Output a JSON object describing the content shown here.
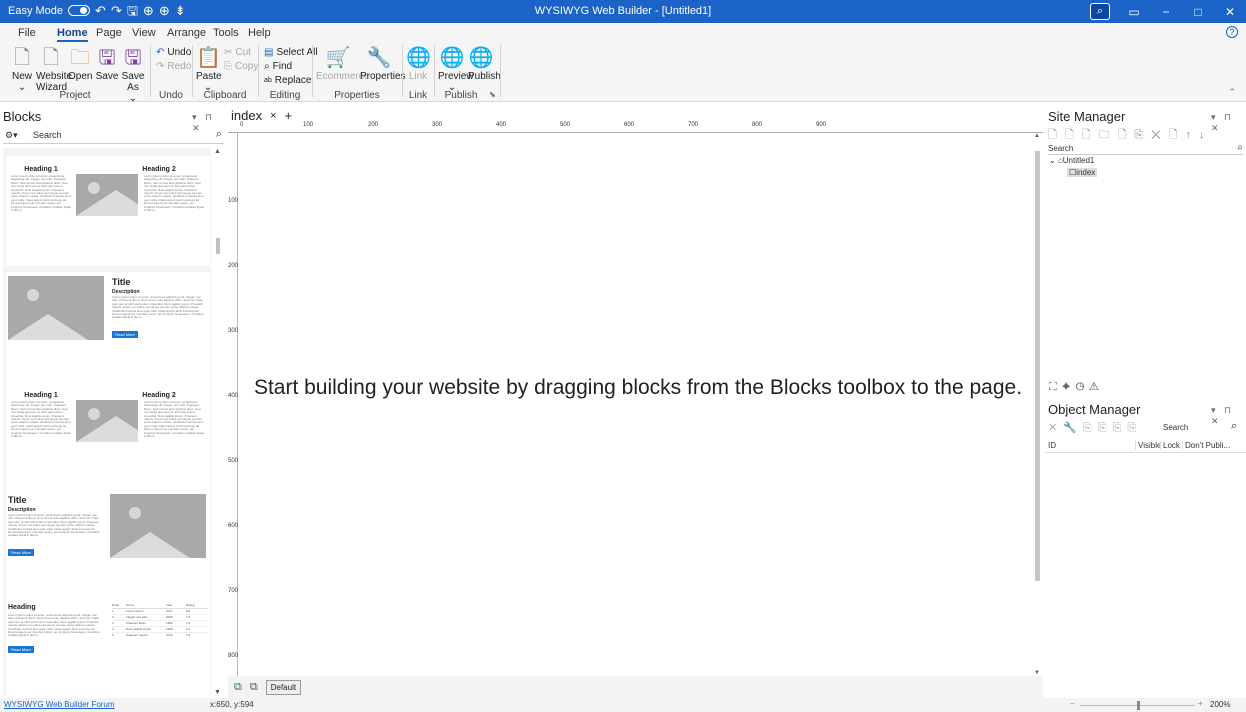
{
  "titlebar": {
    "easy_mode": "Easy Mode",
    "title": "WYSIWYG Web Builder - [Untitled1]",
    "minimize": "−",
    "maximize": "□",
    "close": "✕"
  },
  "menu": {
    "tabs": [
      "File",
      "Home",
      "Page",
      "View",
      "Arrange",
      "Tools",
      "Help"
    ],
    "help": "?"
  },
  "ribbon": {
    "new": "New",
    "website_wizard": "Website Wizard",
    "open": "Open",
    "save": "Save",
    "save_as": "Save As",
    "project_group": "Project",
    "undo": "Undo",
    "redo": "Redo",
    "undo_group": "Undo",
    "paste": "Paste",
    "cut": "Cut",
    "copy": "Copy",
    "clipboard_group": "Clipboard",
    "select_all": "Select All",
    "find": "Find",
    "replace": "Replace",
    "editing_group": "Editing",
    "ecommerce": "Ecommerce",
    "properties": "Properties",
    "properties_group": "Properties",
    "link": "Link",
    "link_group": "Link",
    "preview": "Preview",
    "publish": "Publish",
    "publish_group": "Publish"
  },
  "blocks": {
    "title": "Blocks",
    "search_placeholder": "Search",
    "card1": {
      "h1": "Heading 1",
      "h2": "Heading 2"
    },
    "card2": {
      "title": "Title",
      "desc": "Description",
      "btn": "Read More"
    },
    "card3": {
      "h1": "Heading 1",
      "h2": "Heading 2"
    },
    "card4": {
      "title": "Title",
      "desc": "Description",
      "btn": "Read More"
    },
    "card5": {
      "title": "Heading",
      "btn": "Read More",
      "cols": [
        "Rank",
        "Name",
        "Year",
        "Rating"
      ],
      "rows": [
        [
          "1",
          "Lorem ipsum",
          "2017",
          "8.8"
        ],
        [
          "2",
          "Integer nec odio",
          "2005",
          "7.6"
        ],
        [
          "3",
          "Praesent libero",
          "1982",
          "7.5"
        ],
        [
          "4",
          "Duis sagittis ipsum",
          "1996",
          "8.1"
        ],
        [
          "5",
          "Praesent mauris",
          "2012",
          "7.9"
        ]
      ]
    },
    "lorem": "Lorem ipsum dolor sit amet, consectetur adipiscing elit. Integer nec odio. Praesent libero. Sed cursus ante dapibus diam. Sed nisi. Nulla quis sem at nibh elementum imperdiet. Duis sagittis ipsum. Praesent mauris. Fusce nec tellus sed augue semper porta. Mauris massa. Vestibulum lacinia arcu eget nulla. Class aptent taciti sociosqu ad litora torquent per conubia nostra, per inceptos himenaeos. Curabitur sodales ligula in libero."
  },
  "editor": {
    "tab": "index",
    "tab_close": "×",
    "tab_add": "+",
    "hruler": [
      "0",
      "100",
      "200",
      "300",
      "400",
      "500",
      "600",
      "700",
      "800",
      "900"
    ],
    "vruler": [
      "100",
      "200",
      "300",
      "400",
      "500",
      "600",
      "700",
      "800"
    ],
    "hint": "Start building your website by dragging blocks from the Blocks toolbox to the page.",
    "breakpoint": "Default"
  },
  "site_manager": {
    "title": "Site Manager",
    "search_label": "Search",
    "root": "Untitled1",
    "page": "index"
  },
  "object_manager": {
    "title": "Object Manager",
    "search_placeholder": "Search",
    "columns": [
      "ID",
      "Visible",
      "Lock",
      "Don't Publi..."
    ]
  },
  "status": {
    "forum": "WYSIWYG Web Builder Forum",
    "coords": "x:650, y:594",
    "zoom": "200%"
  }
}
